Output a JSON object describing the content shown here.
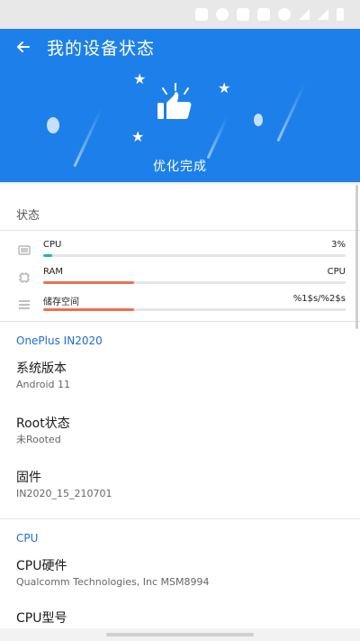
{
  "header": {
    "title": "我的设备状态",
    "done_text": "优化完成"
  },
  "status_section": {
    "title": "状态",
    "rows": [
      {
        "name": "CPU",
        "value": "3%",
        "fill": 0.03,
        "color": "#1fb5b0"
      },
      {
        "name": "RAM",
        "value": "CPU",
        "fill": 0.3,
        "color": "#ef6f53"
      },
      {
        "name": "储存空间",
        "value": "%1$s/%2$s",
        "fill": 0.3,
        "color": "#ef6f53"
      }
    ]
  },
  "device_section": {
    "title": "OnePlus IN2020",
    "items": [
      {
        "label": "系统版本",
        "value": "Android 11"
      },
      {
        "label": "Root状态",
        "value": "未Rooted"
      },
      {
        "label": "固件",
        "value": "IN2020_15_210701"
      }
    ]
  },
  "cpu_section": {
    "title": "CPU",
    "items": [
      {
        "label": "CPU硬件",
        "value": "Qualcomm Technologies, Inc MSM8994"
      },
      {
        "label": "CPU型号",
        "value": ""
      }
    ]
  },
  "colors": {
    "accent": "#1d80ea",
    "section_link": "#1e6bd6"
  },
  "icons": [
    "back-arrow-icon",
    "thumbs-up-icon",
    "star-icon",
    "monitor-icon",
    "chip-icon",
    "storage-list-icon"
  ]
}
